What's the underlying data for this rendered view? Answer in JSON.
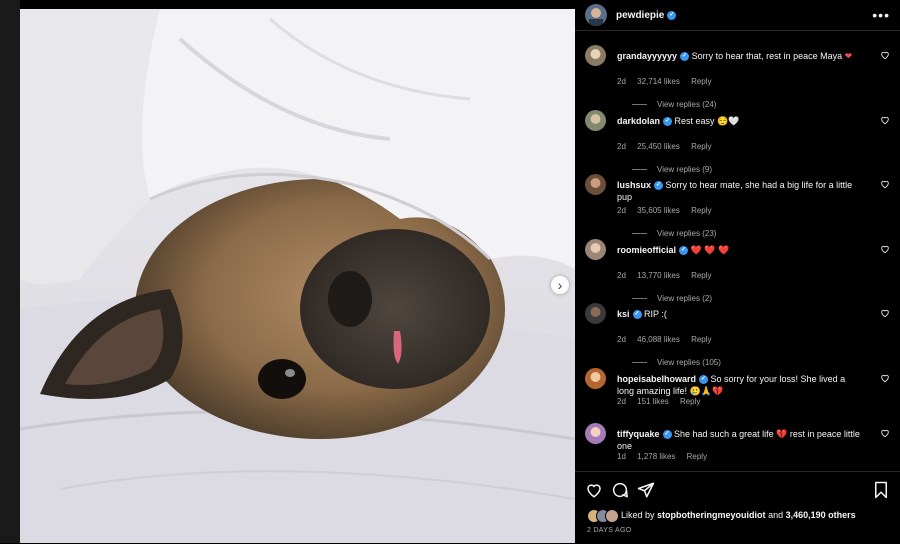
{
  "post": {
    "author": "pewdiepie",
    "verified": true,
    "image_alt": "pug under white blanket"
  },
  "comments": [
    {
      "user": "grandayyyyyy",
      "text": "Sorry to hear that, rest in peace Maya",
      "emoji": "❤",
      "time": "2d",
      "likes": "32,714 likes",
      "reply": "Reply",
      "view_replies": "View replies (24)"
    },
    {
      "user": "darkdolan",
      "text": "Rest easy",
      "emoji": "😌🤍",
      "time": "2d",
      "likes": "25,450 likes",
      "reply": "Reply",
      "view_replies": "View replies (9)"
    },
    {
      "user": "lushsux",
      "text": "Sorry to hear mate, she had a big life for a little pup",
      "emoji": "",
      "time": "2d",
      "likes": "35,605 likes",
      "reply": "Reply",
      "view_replies": "View replies (23)"
    },
    {
      "user": "roomieofficial",
      "text": "",
      "emoji": "❤️ ❤️ ❤️",
      "time": "2d",
      "likes": "13,770 likes",
      "reply": "Reply",
      "view_replies": "View replies (2)"
    },
    {
      "user": "ksi",
      "text": "RIP :(",
      "emoji": "",
      "time": "2d",
      "likes": "46,088 likes",
      "reply": "Reply",
      "view_replies": "View replies (105)"
    },
    {
      "user": "hopeisabelhoward",
      "text": "So sorry for your loss! She lived a long amazing life!",
      "emoji": "🥲🙏💔",
      "time": "2d",
      "likes": "151 likes",
      "reply": "Reply",
      "view_replies": ""
    },
    {
      "user": "tiffyquake",
      "text": "She had such a great life",
      "emoji": "💔",
      "text2": "rest in peace little one",
      "time": "1d",
      "likes": "1,278 likes",
      "reply": "Reply",
      "view_replies": ""
    }
  ],
  "footer": {
    "liked_prefix": "Liked by",
    "liked_user": "stopbotheringmeyouidiot",
    "liked_and": "and",
    "liked_count": "3,460,190 others",
    "date": "2 DAYS AGO"
  },
  "colors": {
    "background": "#000000",
    "accent_verified": "#3897f0",
    "heart": "#ed4956",
    "secondary_text": "#a8a8a8"
  },
  "icons": [
    "heart-icon",
    "comment-icon",
    "share-icon",
    "bookmark-icon",
    "more-icon",
    "chevron-right-icon",
    "verified-icon"
  ]
}
